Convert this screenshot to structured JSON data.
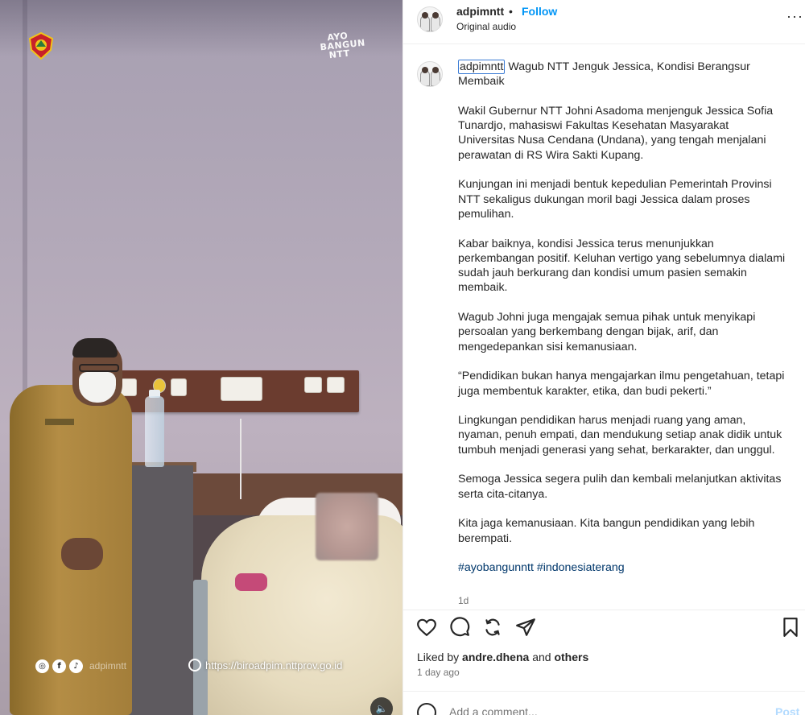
{
  "media": {
    "overlay_logo_text": "AYO BANGUN NTT",
    "overlay_socials": [
      "instagram-icon",
      "facebook-icon",
      "tiktok-icon"
    ],
    "overlay_handle": "adpimntt",
    "overlay_url": "https://biroadpim.nttprov.go.id"
  },
  "header": {
    "username": "adpimntt",
    "separator": "•",
    "follow_label": "Follow",
    "audio": "Original audio",
    "more": "···"
  },
  "caption": {
    "username": "adpimntt",
    "title": "Wagub NTT Jenguk Jessica, Kondisi Berangsur Membaik",
    "paragraphs": [
      "Wakil Gubernur NTT Johni Asadoma menjenguk Jessica Sofia Tunardjo, mahasiswi Fakultas Kesehatan Masyarakat Universitas Nusa Cendana (Undana), yang tengah menjalani perawatan di RS Wira Sakti Kupang.",
      "Kunjungan ini menjadi bentuk kepedulian Pemerintah Provinsi NTT sekaligus dukungan moril bagi Jessica dalam proses pemulihan.",
      "Kabar baiknya, kondisi Jessica terus menunjukkan perkembangan positif. Keluhan vertigo yang sebelumnya dialami sudah jauh berkurang dan kondisi umum pasien semakin membaik.",
      "Wagub Johni juga mengajak semua pihak untuk menyikapi persoalan yang berkembang dengan bijak, arif, dan mengedepankan sisi kemanusiaan.",
      "“Pendidikan bukan hanya mengajarkan ilmu pengetahuan, tetapi juga membentuk karakter, etika, dan budi pekerti.”",
      "Lingkungan pendidikan harus menjadi ruang yang aman, nyaman, penuh empati, dan mendukung setiap anak didik untuk tumbuh menjadi generasi yang sehat, berkarakter, dan unggul.",
      "Semoga Jessica segera pulih dan kembali melanjutkan aktivitas serta cita-citanya.",
      "Kita jaga kemanusiaan. Kita bangun pendidikan yang lebih berempati."
    ],
    "hashtags": "#ayobangunntt #indonesiaterang",
    "time": "1d"
  },
  "actions": {
    "icons": [
      "heart-icon",
      "comment-icon",
      "repost-icon",
      "share-icon",
      "bookmark-icon"
    ]
  },
  "likes": {
    "prefix": "Liked by",
    "user": "andre.dhena",
    "and": "and",
    "others": "others",
    "ago": "1 day ago"
  },
  "comment": {
    "placeholder": "Add a comment...",
    "post_label": "Post"
  },
  "colors": {
    "accent": "#0095f6",
    "hashtag": "#00376b",
    "post_disabled": "#b3dbff"
  }
}
